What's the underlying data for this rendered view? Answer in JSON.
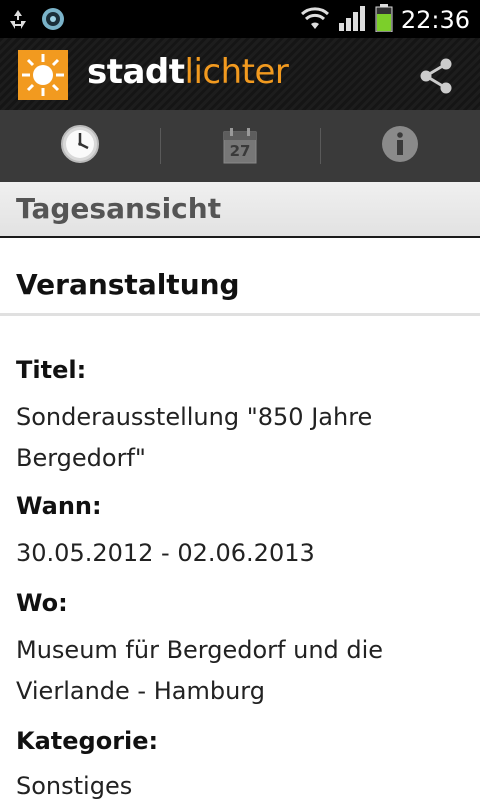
{
  "status_bar": {
    "time": "22:36",
    "icons": [
      "recycle-icon",
      "camera-icon",
      "wifi-icon",
      "signal-icon",
      "battery-icon"
    ]
  },
  "action_bar": {
    "brand_part1": "stadt",
    "brand_part2": "lichter",
    "logo": "sun-logo-icon",
    "share_icon": "share-icon"
  },
  "tabs": [
    {
      "icon": "clock-icon"
    },
    {
      "icon": "calendar-icon",
      "day": "27"
    },
    {
      "icon": "info-icon"
    }
  ],
  "section_title": "Tagesansicht",
  "event_heading": "Veranstaltung",
  "fields": {
    "title_label": "Titel:",
    "title_value_line1": "Sonderausstellung \"850 Jahre",
    "title_value_line2": "Bergedorf\"",
    "when_label": "Wann:",
    "when_value": "30.05.2012 - 02.06.2013",
    "where_label": "Wo:",
    "where_value_line1": "Museum für Bergedorf und die",
    "where_value_line2": "Vierlande - Hamburg",
    "category_label": "Kategorie:",
    "category_value": "Sonstiges"
  },
  "colors": {
    "brand_orange": "#f29a1f",
    "tabbar_bg": "#3a3a3a",
    "actionbar_bg": "#1a1a1a"
  }
}
